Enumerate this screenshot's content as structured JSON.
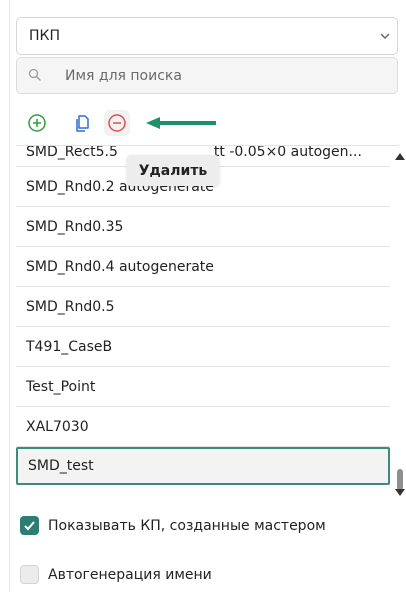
{
  "type_select": {
    "value": "ПКП"
  },
  "search": {
    "placeholder": "Имя для поиска",
    "value": ""
  },
  "tooltip": {
    "text": "Удалить"
  },
  "list": {
    "partial_item": "SMD_Rect5.5",
    "partial_item_tail": "tt -0.05×0 autogen...",
    "items": [
      "SMD_Rnd0.2 autogenerate",
      "SMD_Rnd0.35",
      "SMD_Rnd0.4 autogenerate",
      "SMD_Rnd0.5",
      "T491_CaseB",
      "Test_Point",
      "XAL7030",
      "SMD_test"
    ],
    "selected_index": 7
  },
  "options": {
    "show_wizard_pads": {
      "label": "Показывать КП, созданные мастером",
      "checked": true
    },
    "auto_name": {
      "label": "Автогенерация имени",
      "checked": false
    }
  },
  "colors": {
    "accent": "#2e7d73",
    "add": "#2e9e3e",
    "delete": "#d9534f",
    "copy": "#2f6fd1",
    "arrow": "#1f8f6a"
  },
  "icons": [
    "chevron-down-icon",
    "search-icon",
    "add-circle-icon",
    "copy-icon",
    "remove-circle-icon",
    "arrow-left-icon",
    "checkmark-icon"
  ]
}
